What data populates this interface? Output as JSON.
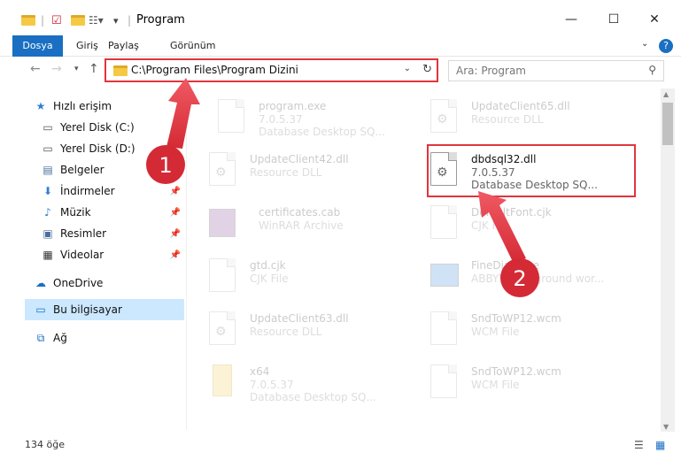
{
  "window": {
    "title": "Program",
    "minimize": "—",
    "maximize": "☐",
    "close": "✕"
  },
  "ribbon": {
    "tabs": [
      "Dosya",
      "Giriş",
      "Paylaş",
      "Görünüm"
    ],
    "help": "?"
  },
  "nav": {
    "address": "C:\\Program Files\\Program Dizini",
    "search_placeholder": "Ara: Program"
  },
  "sidebar": {
    "items": [
      {
        "label": "Hızlı erişim",
        "icon": "star-icon"
      },
      {
        "label": "Yerel Disk (C:)",
        "icon": "drive-icon"
      },
      {
        "label": "Yerel Disk (D:)",
        "icon": "drive-icon"
      },
      {
        "label": "Belgeler",
        "icon": "documents-icon"
      },
      {
        "label": "İndirmeler",
        "icon": "download-icon"
      },
      {
        "label": "Müzik",
        "icon": "music-icon"
      },
      {
        "label": "Resimler",
        "icon": "pictures-icon"
      },
      {
        "label": "Videolar",
        "icon": "videos-icon"
      },
      {
        "label": "OneDrive",
        "icon": "cloud-icon"
      },
      {
        "label": "Bu bilgisayar",
        "icon": "computer-icon"
      },
      {
        "label": "Ağ",
        "icon": "network-icon"
      }
    ]
  },
  "files": [
    {
      "name": "program.exe",
      "line2": "7.0.5.37",
      "line3": "Database Desktop SQ..."
    },
    {
      "name": "UpdateClient65.dll",
      "line2": "Resource DLL",
      "line3": ""
    },
    {
      "name": "UpdateClient42.dll",
      "line2": "Resource DLL",
      "line3": ""
    },
    {
      "name": "dbdsql32.dll",
      "line2": "7.0.5.37",
      "line3": "Database Desktop SQ..."
    },
    {
      "name": "certificates.cab",
      "line2": "WinRAR Archive",
      "line3": ""
    },
    {
      "name": "DefaultFont.cjk",
      "line2": "CJK File",
      "line3": ""
    },
    {
      "name": "gtd.cjk",
      "line2": "CJK File",
      "line3": ""
    },
    {
      "name": "FineDiag.exe",
      "line2": "ABBYY Background wor...",
      "line3": ""
    },
    {
      "name": "UpdateClient63.dll",
      "line2": "Resource DLL",
      "line3": ""
    },
    {
      "name": "SndToWP12.wcm",
      "line2": "WCM File",
      "line3": ""
    },
    {
      "name": "x64",
      "line2": "7.0.5.37",
      "line3": "Database Desktop SQ..."
    },
    {
      "name": "SndToWP12.wcm",
      "line2": "WCM File",
      "line3": ""
    }
  ],
  "status": {
    "count": "134 öğe"
  },
  "annotations": {
    "marker1": "1",
    "marker2": "2"
  },
  "colors": {
    "accent": "#1a6fc2",
    "highlight": "#e0353d",
    "selected_nav": "#cce8ff"
  }
}
